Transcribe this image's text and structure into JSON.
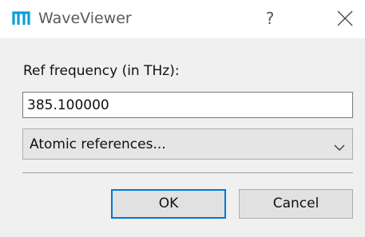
{
  "window": {
    "title": "WaveViewer",
    "help_label": "?",
    "icon": "waveviewer-logo-icon",
    "close_icon": "close-icon"
  },
  "form": {
    "ref_frequency_label": "Ref frequency (in THz):",
    "ref_frequency_value": "385.100000",
    "atomic_references_selected": "Atomic references..."
  },
  "buttons": {
    "ok_label": "OK",
    "cancel_label": "Cancel"
  },
  "colors": {
    "accent": "#0078d7",
    "logo": "#0a9fd8"
  }
}
